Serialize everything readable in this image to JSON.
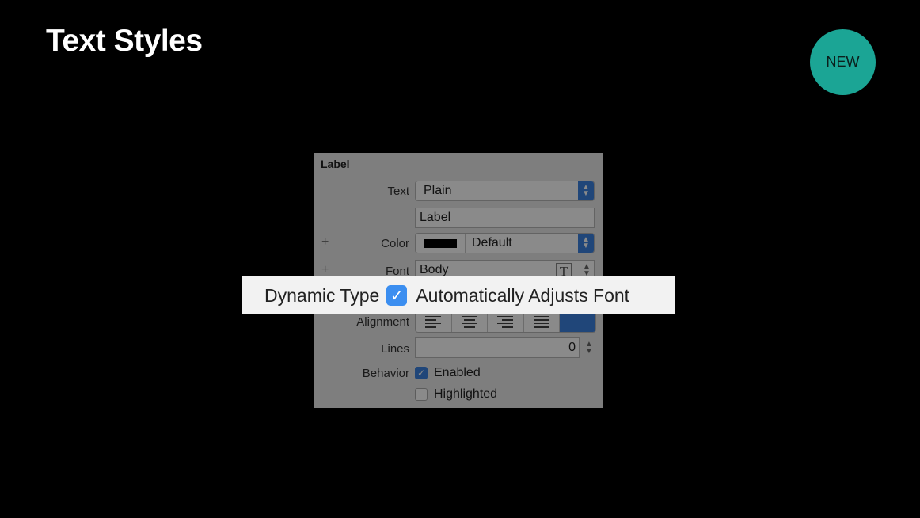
{
  "slide": {
    "title": "Text Styles",
    "badge": "NEW"
  },
  "panel": {
    "section_title": "Label",
    "text": {
      "label": "Text",
      "value": "Plain"
    },
    "text_field_value": "Label",
    "color": {
      "label": "Color",
      "value": "Default",
      "swatch": "#000000"
    },
    "font": {
      "label": "Font",
      "value": "Body",
      "icon": "T"
    },
    "alignment": {
      "label": "Alignment",
      "options": [
        "left",
        "center",
        "right",
        "justified",
        "natural"
      ],
      "selected": "natural"
    },
    "lines": {
      "label": "Lines",
      "value": "0"
    },
    "behavior": {
      "label": "Behavior",
      "enabled": {
        "label": "Enabled",
        "checked": true
      },
      "highlighted": {
        "label": "Highlighted",
        "checked": false
      }
    }
  },
  "callout": {
    "label": "Dynamic Type",
    "checkbox_label": "Automatically Adjusts Font",
    "checked": true
  },
  "colors": {
    "badge": "#1ba595",
    "accent": "#3b82e0",
    "background": "#000000"
  }
}
